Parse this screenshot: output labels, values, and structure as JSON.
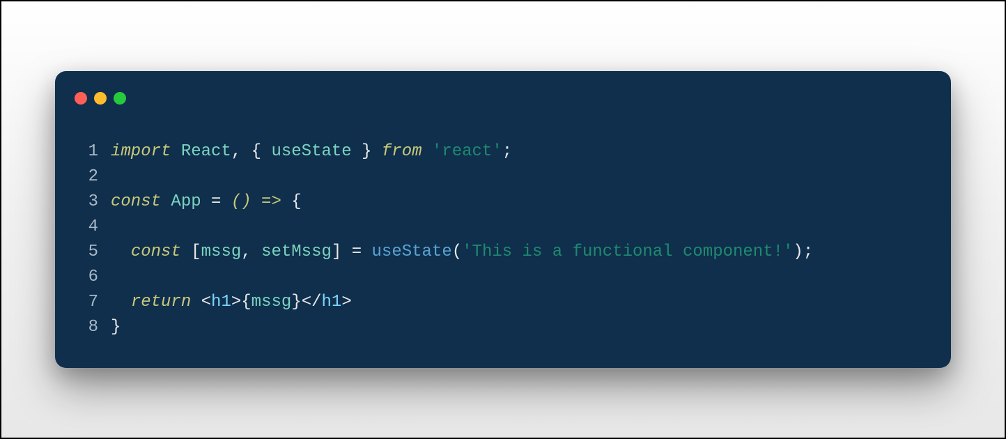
{
  "window": {
    "controls": {
      "close": "close-window",
      "minimize": "minimize-window",
      "maximize": "maximize-window"
    }
  },
  "code": {
    "lines": [
      {
        "num": "1"
      },
      {
        "num": "2"
      },
      {
        "num": "3"
      },
      {
        "num": "4"
      },
      {
        "num": "5"
      },
      {
        "num": "6"
      },
      {
        "num": "7"
      },
      {
        "num": "8"
      }
    ],
    "tokens": {
      "l1_import": "import",
      "l1_react": " React",
      "l1_comma": ", ",
      "l1_bopen": "{ ",
      "l1_usestate": "useState",
      "l1_bclose": " } ",
      "l1_from": "from",
      "l1_sp": " ",
      "l1_str": "'react'",
      "l1_semi": ";",
      "l3_const": "const",
      "l3_app": " App ",
      "l3_eq": "= ",
      "l3_parens": "(",
      "l3_parens2": ")",
      "l3_arrow": " => ",
      "l3_brace": "{",
      "l5_indent": "  ",
      "l5_const": "const",
      "l5_sp": " ",
      "l5_bopen": "[",
      "l5_mssg": "mssg",
      "l5_comma": ", ",
      "l5_setmssg": "setMssg",
      "l5_bclose": "] ",
      "l5_eq": "= ",
      "l5_usestate": "useState",
      "l5_popen": "(",
      "l5_str": "'This is a functional component!'",
      "l5_pclose": ")",
      "l5_semi": ";",
      "l7_indent": "  ",
      "l7_return": "return",
      "l7_sp": " ",
      "l7_lt": "<",
      "l7_h1o": "h1",
      "l7_gt": ">",
      "l7_bopen": "{",
      "l7_mssg": "mssg",
      "l7_bclose": "}",
      "l7_lt2": "</",
      "l7_h1c": "h1",
      "l7_gt2": ">",
      "l8_brace": "}"
    }
  }
}
